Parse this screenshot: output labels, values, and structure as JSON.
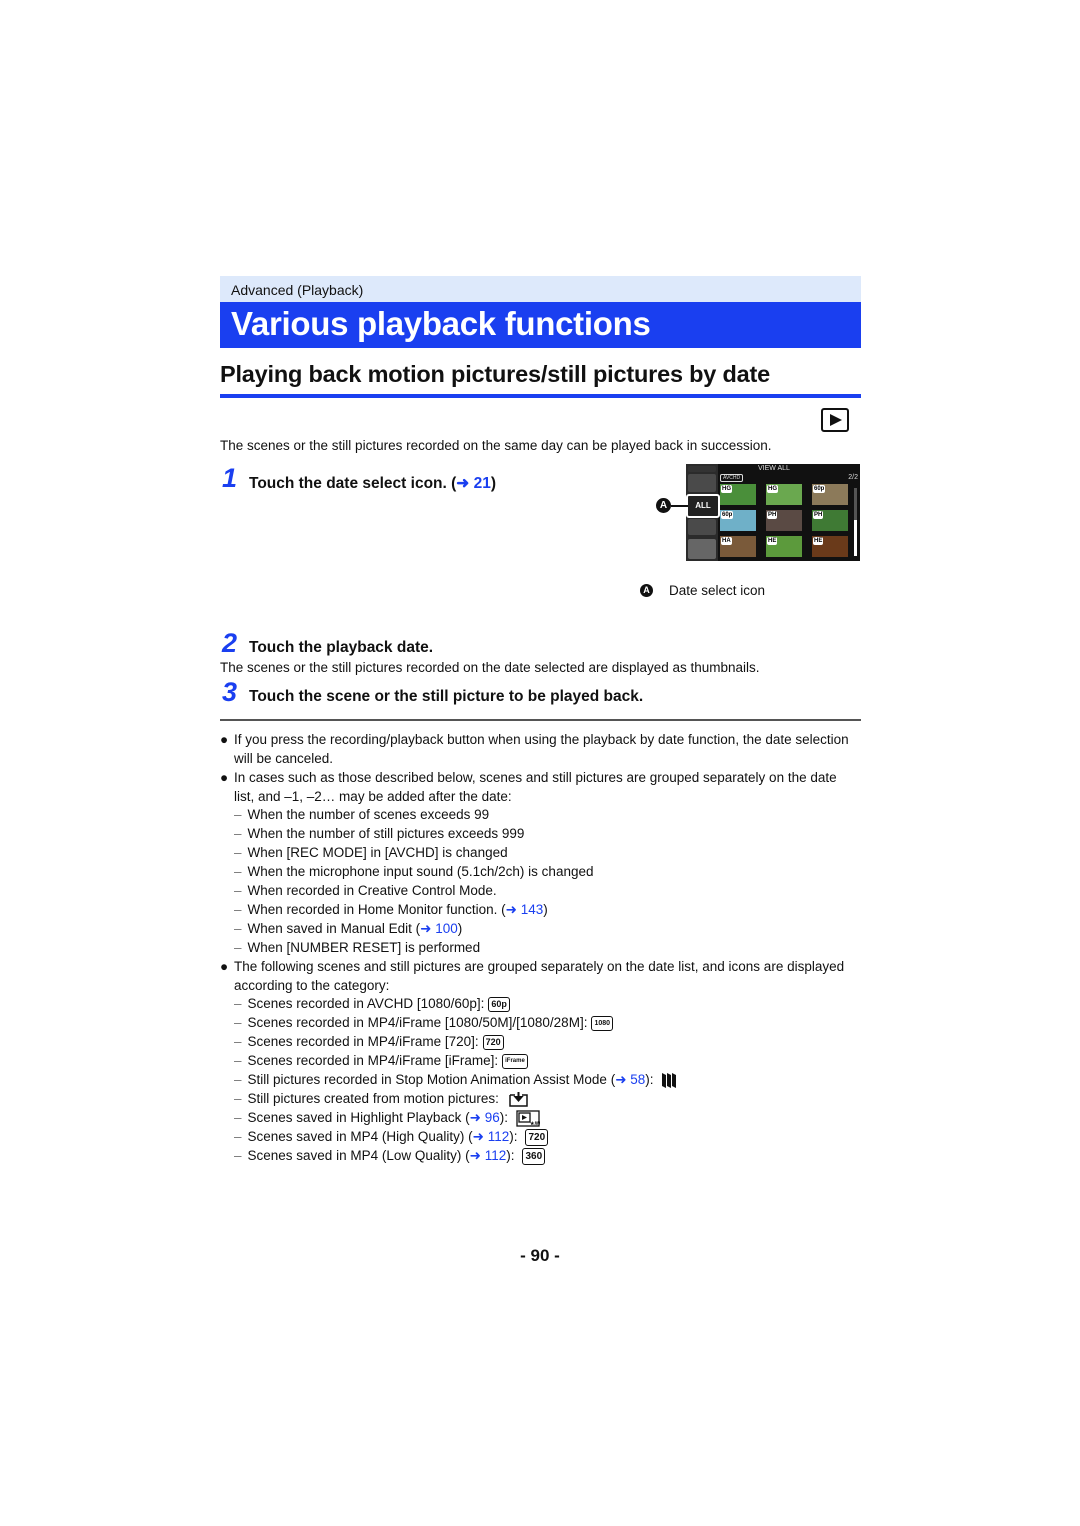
{
  "section_label": "Advanced (Playback)",
  "page_title": "Various playback functions",
  "heading": "Playing back motion pictures/still pictures by date",
  "mode_icon": "playback-mode-icon",
  "intro": "The scenes or the still pictures recorded on the same day can be played back in succession.",
  "steps": [
    {
      "num": "1",
      "text": "Touch the date select icon. (",
      "ref": "21",
      "suffix": ")"
    },
    {
      "num": "2",
      "text": "Touch the playback date.",
      "desc": "The scenes or the still pictures recorded on the date selected are displayed as thumbnails."
    },
    {
      "num": "3",
      "text": "Touch the scene or the still picture to be played back."
    }
  ],
  "screen": {
    "header": "VIEW ALL",
    "format": "AVCHD",
    "page": "2/2",
    "all_button": "ALL",
    "thumb_tags": [
      "HG",
      "HG",
      "60p",
      "60p",
      "PH",
      "PH",
      "HA",
      "HE",
      "HE"
    ]
  },
  "callout": {
    "letter": "A",
    "label": "Date select icon"
  },
  "arrow": "➜",
  "notes": [
    {
      "text": "If you press the recording/playback button when using the playback by date function, the date selection will be canceled."
    },
    {
      "text": "In cases such as those described below, scenes and still pictures are grouped separately on the date list, and –1, –2… may be added after the date:",
      "items": [
        {
          "text": "When the number of scenes exceeds 99"
        },
        {
          "text": "When the number of still pictures exceeds 999"
        },
        {
          "text": "When [REC MODE] in [AVCHD] is changed"
        },
        {
          "text": "When the microphone input sound (5.1ch/2ch) is changed"
        },
        {
          "text": "When recorded in Creative Control Mode."
        },
        {
          "text": "When recorded in Home Monitor function. (",
          "ref": "143",
          "suffix": ")"
        },
        {
          "text": "When saved in Manual Edit (",
          "ref": "100",
          "suffix": ")"
        },
        {
          "text": "When [NUMBER RESET] is performed"
        }
      ]
    },
    {
      "text": "The following scenes and still pictures are grouped separately on the date list, and icons are displayed according to the category:",
      "items": [
        {
          "text": "Scenes recorded in AVCHD [1080/60p]:",
          "badge": "60p"
        },
        {
          "text": "Scenes recorded in MP4/iFrame [1080/50M]/[1080/28M]:",
          "badge": "1080"
        },
        {
          "text": "Scenes recorded in MP4/iFrame [720]:",
          "badge": "720"
        },
        {
          "text": "Scenes recorded in MP4/iFrame [iFrame]:",
          "badge": "iFrame"
        },
        {
          "text": "Still pictures recorded in Stop Motion Animation Assist Mode (",
          "ref": "58",
          "suffix": "):",
          "icon": "stop-motion-icon"
        },
        {
          "text": "Still pictures created from motion pictures:",
          "icon": "still-from-motion-icon"
        },
        {
          "text": "Scenes saved in Highlight Playback (",
          "ref": "96",
          "suffix": "):",
          "icon": "highlight-playback-icon"
        },
        {
          "text": "Scenes saved in MP4 (High Quality) (",
          "ref": "112",
          "suffix": "):",
          "badge": "720"
        },
        {
          "text": "Scenes saved in MP4 (Low Quality) (",
          "ref": "112",
          "suffix": "):",
          "badge": "360"
        }
      ]
    }
  ],
  "page_number": "- 90 -"
}
